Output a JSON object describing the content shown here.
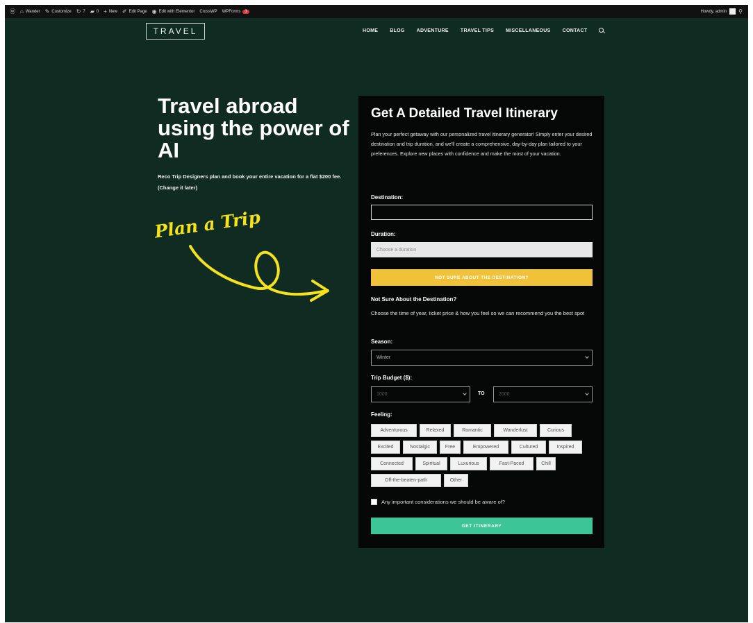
{
  "adminbar": {
    "site_name": "Wander",
    "customize": "Customize",
    "updates": "7",
    "comments": "0",
    "new": "New",
    "edit_page": "Edit Page",
    "elementor": "Edit with Elementor",
    "crosswp": "CrossWP",
    "wpforms": "WPForms",
    "wpforms_badge": "3",
    "howdy": "Howdy, admin"
  },
  "header": {
    "logo": "TRAVEL",
    "nav": [
      "HOME",
      "BLOG",
      "ADVENTURE",
      "TRAVEL TIPS",
      "MISCELLANEOUS",
      "CONTACT"
    ]
  },
  "hero": {
    "title": "Travel abroad using the power of AI",
    "subtitle": "Reco Trip Designers plan and book your entire vacation for a flat $200 fee. (Change it later)",
    "handwritten": "Plan a Trip"
  },
  "form": {
    "title": "Get A Detailed Travel Itinerary",
    "description": "Plan your perfect getaway with our personalized travel itinerary generator! Simply enter your desired destination and trip duration, and we'll create a comprehensive, day-by-day plan tailored to your preferences. Explore new places with confidence and make the most of your vacation.",
    "destination_label": "Destination:",
    "destination_value": "",
    "duration_label": "Duration:",
    "duration_placeholder": "Choose a duration",
    "not_sure_button": "NOT SURE ABOUT THE DESTINATION?",
    "not_sure_heading": "Not Sure About the Destination?",
    "not_sure_desc": "Choose the time of year, ticket price & how you feel so we can recommend you the best spot",
    "season_label": "Season:",
    "season_value": "Winter",
    "budget_label": "Trip Budget ($):",
    "budget_min": "1000",
    "budget_to": "TO",
    "budget_max": "2000",
    "feeling_label": "Feeling:",
    "feelings": [
      "Adventurous",
      "Relaxed",
      "Romantic",
      "Wanderlust",
      "Curious",
      "Excited",
      "Nostalgic",
      "Free",
      "Empowered",
      "Cultured",
      "Inspired",
      "Connected",
      "Spiritual",
      "Luxurious",
      "Fast-Paced",
      "Chill",
      "Off-the-beaten-path",
      "Other"
    ],
    "consider_label": "Any important considerations we should be aware of?",
    "submit_button": "GET ITINERARY"
  },
  "colors": {
    "background": "#0f2b22",
    "card": "#050606",
    "accent_yellow": "#f0c23b",
    "accent_green": "#3cc596",
    "handwriting": "#f4e21c"
  }
}
